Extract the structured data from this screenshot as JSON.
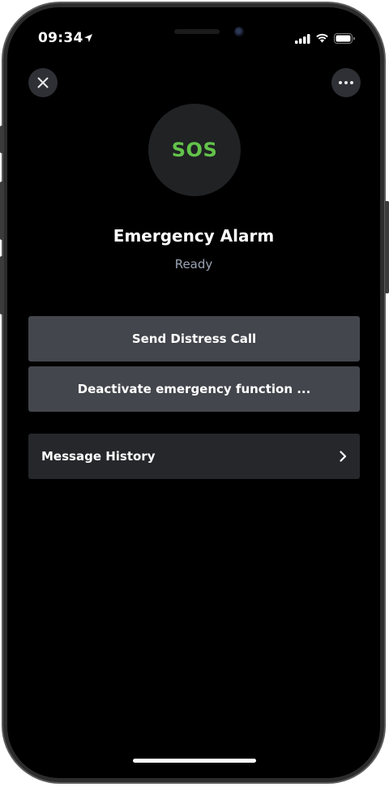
{
  "status_bar": {
    "time": "09:34",
    "icons": [
      "location-arrow-icon",
      "cellular-signal-icon",
      "wifi-icon",
      "battery-icon"
    ]
  },
  "header": {
    "close_icon": "close-icon",
    "more_icon": "more-icon"
  },
  "sos": {
    "label": "SOS",
    "color": "#63c34a"
  },
  "title": "Emergency Alarm",
  "status": "Ready",
  "actions": {
    "send_distress": "Send Distress Call",
    "deactivate": "Deactivate emergency function ..."
  },
  "history": {
    "label": "Message History",
    "chevron_icon": "chevron-right-icon"
  },
  "colors": {
    "background": "#000000",
    "button": "#43464c",
    "row": "#25272b",
    "accent": "#63c34a",
    "muted_text": "#9aa4b4"
  }
}
